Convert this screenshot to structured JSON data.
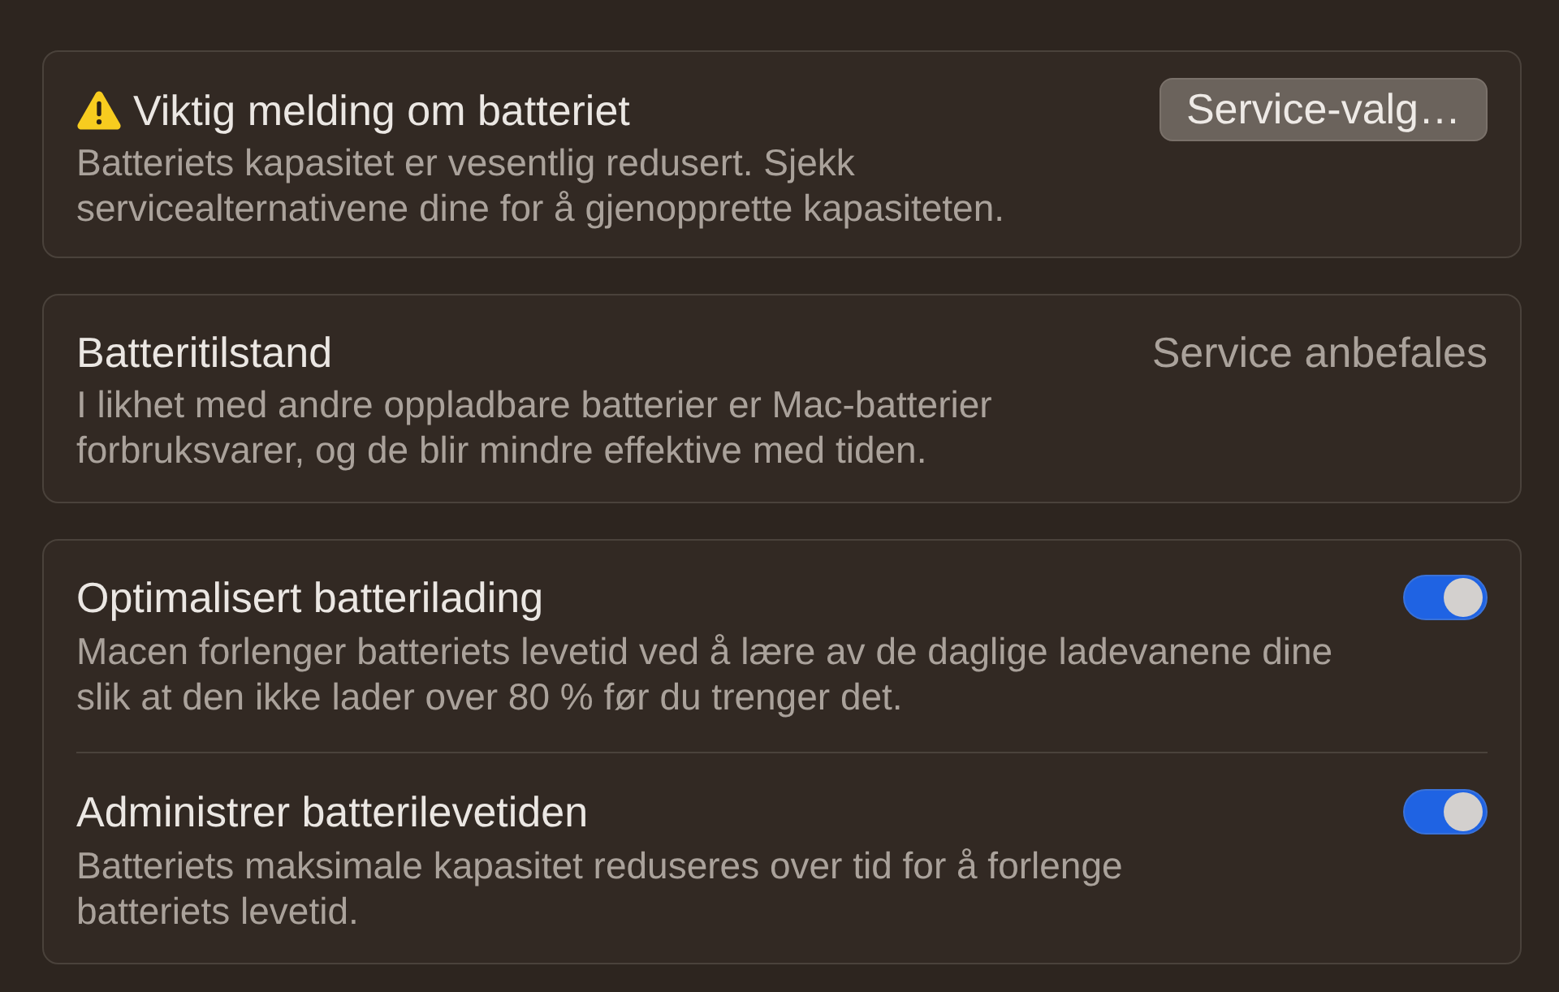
{
  "alert_card": {
    "title": "Viktig melding om batteriet",
    "description": "Batteriets kapasitet er vesentlig redusert. Sjekk servicealternativene dine for å gjenopprette kapasiteten.",
    "button": "Service-valg…"
  },
  "health_card": {
    "title": "Batteritilstand",
    "status": "Service anbefales",
    "description": "I likhet med andre oppladbare batterier er Mac-batterier forbruksvarer, og de blir mindre effektive med tiden."
  },
  "settings": [
    {
      "title": "Optimalisert batterilading",
      "description": "Macen forlenger batteriets levetid ved å lære av de daglige ladevanene dine slik at den ikke lader over 80 % før du trenger det.",
      "on": true
    },
    {
      "title": "Administrer batterilevetiden",
      "description": "Batteriets maksimale kapasitet reduseres over tid for å forlenge batteriets levetid.",
      "on": true
    }
  ]
}
